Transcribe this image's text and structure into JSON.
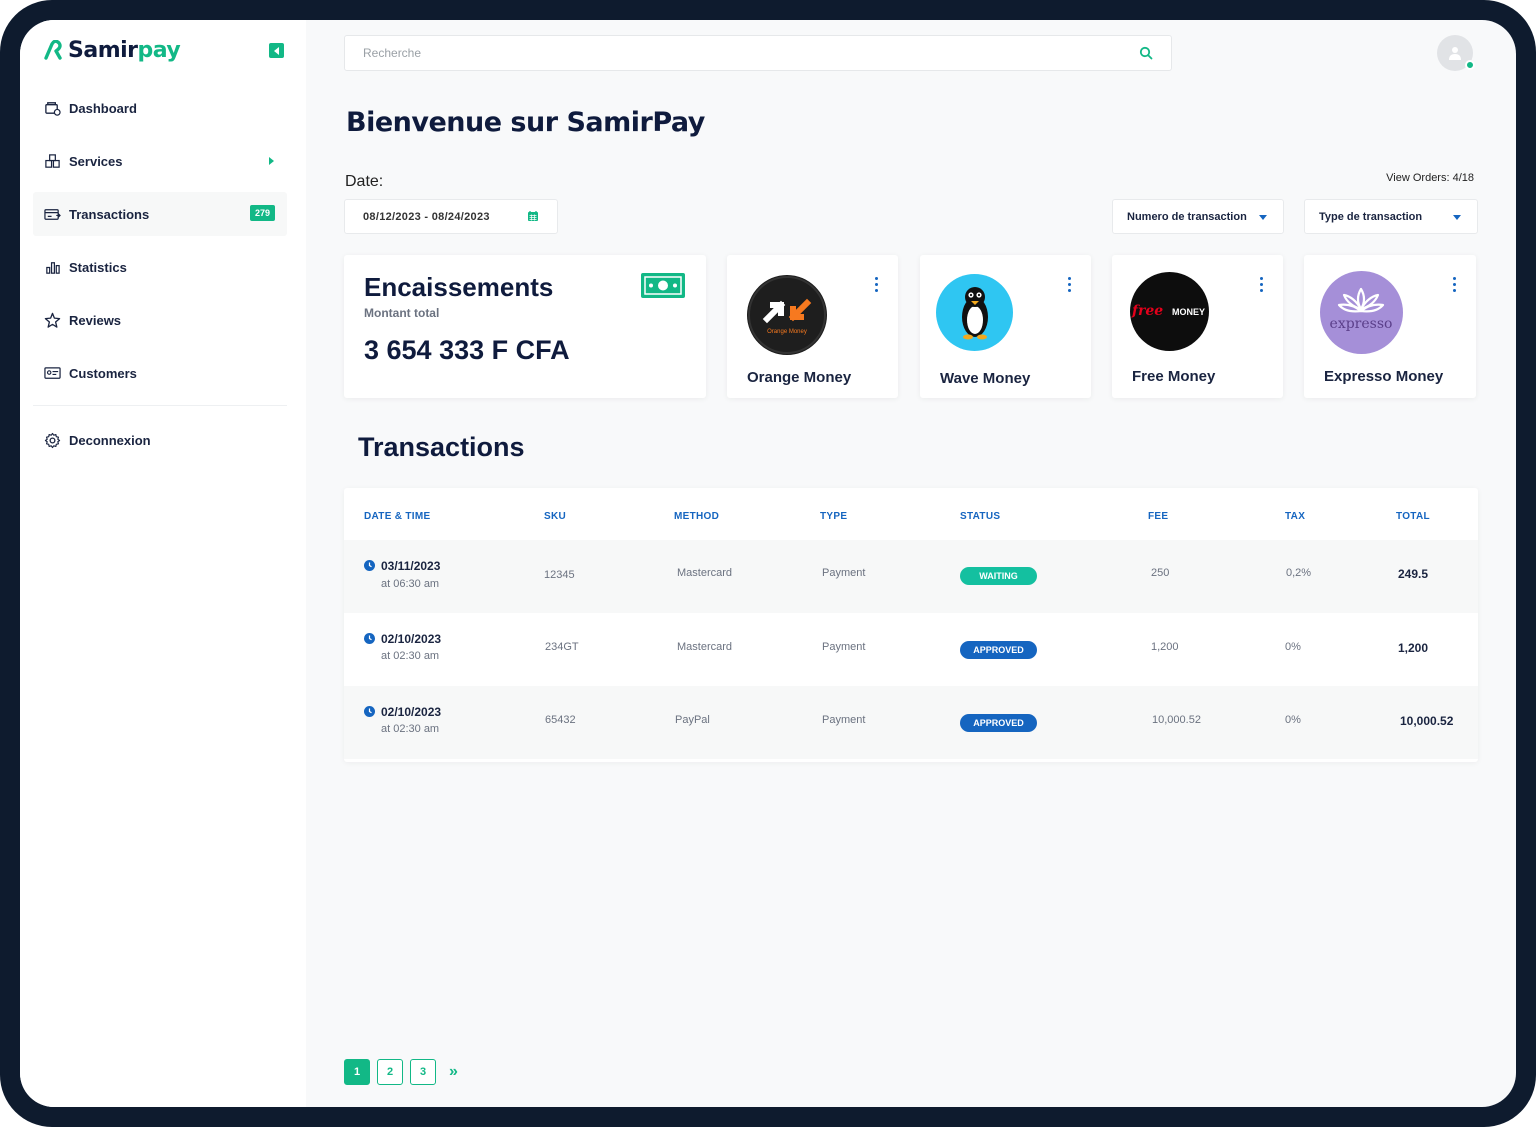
{
  "brand": {
    "name_part1": "Samir",
    "name_part2": "pay",
    "accent_color": "#12b886"
  },
  "sidebar": {
    "items": [
      {
        "label": "Dashboard",
        "icon": "dashboard-icon"
      },
      {
        "label": "Services",
        "icon": "services-icon"
      },
      {
        "label": "Transactions",
        "icon": "transactions-icon",
        "badge": "279"
      },
      {
        "label": "Statistics",
        "icon": "statistics-icon"
      },
      {
        "label": "Reviews",
        "icon": "star-icon"
      },
      {
        "label": "Customers",
        "icon": "customers-icon"
      }
    ],
    "logout_label": "Deconnexion"
  },
  "header": {
    "search_placeholder": "Recherche"
  },
  "main": {
    "title": "Bienvenue sur SamirPay",
    "date_label": "Date:",
    "date_range": "08/12/2023 - 08/24/2023",
    "view_orders": "View Orders: 4/18",
    "filter_number": "Numero de transaction",
    "filter_type": "Type de transaction"
  },
  "summary": {
    "title": "Encaissements",
    "subtitle": "Montant total",
    "amount": "3 654 333 F CFA"
  },
  "providers": [
    {
      "name": "Orange Money",
      "logo_text": "Orange Money"
    },
    {
      "name": "Wave Money"
    },
    {
      "name": "Free Money",
      "logo_text_a": "free",
      "logo_text_b": "MONEY"
    },
    {
      "name": "Expresso Money",
      "logo_text": "expresso"
    }
  ],
  "transactions": {
    "title": "Transactions",
    "columns": [
      "DATE & TIME",
      "SKU",
      "METHOD",
      "TYPE",
      "STATUS",
      "FEE",
      "TAX",
      "TOTAL"
    ],
    "rows": [
      {
        "date": "03/11/2023",
        "time": "at 06:30 am",
        "sku": "12345",
        "method": "Mastercard",
        "type": "Payment",
        "status": "WAITING",
        "fee": "250",
        "tax": "0,2%",
        "total": "249.5"
      },
      {
        "date": "02/10/2023",
        "time": "at 02:30 am",
        "sku": "234GT",
        "method": "Mastercard",
        "type": "Payment",
        "status": "APPROVED",
        "fee": "1,200",
        "tax": "0%",
        "total": "1,200"
      },
      {
        "date": "02/10/2023",
        "time": "at 02:30 am",
        "sku": "65432",
        "method": "PayPal",
        "type": "Payment",
        "status": "APPROVED",
        "fee": "10,000.52",
        "tax": "0%",
        "total": "10,000.52"
      }
    ],
    "status_colors": {
      "WAITING": "#14c0a0",
      "APPROVED": "#1565c0"
    }
  },
  "pagination": {
    "pages": [
      "1",
      "2",
      "3"
    ],
    "current": "1",
    "next_label": "»"
  }
}
